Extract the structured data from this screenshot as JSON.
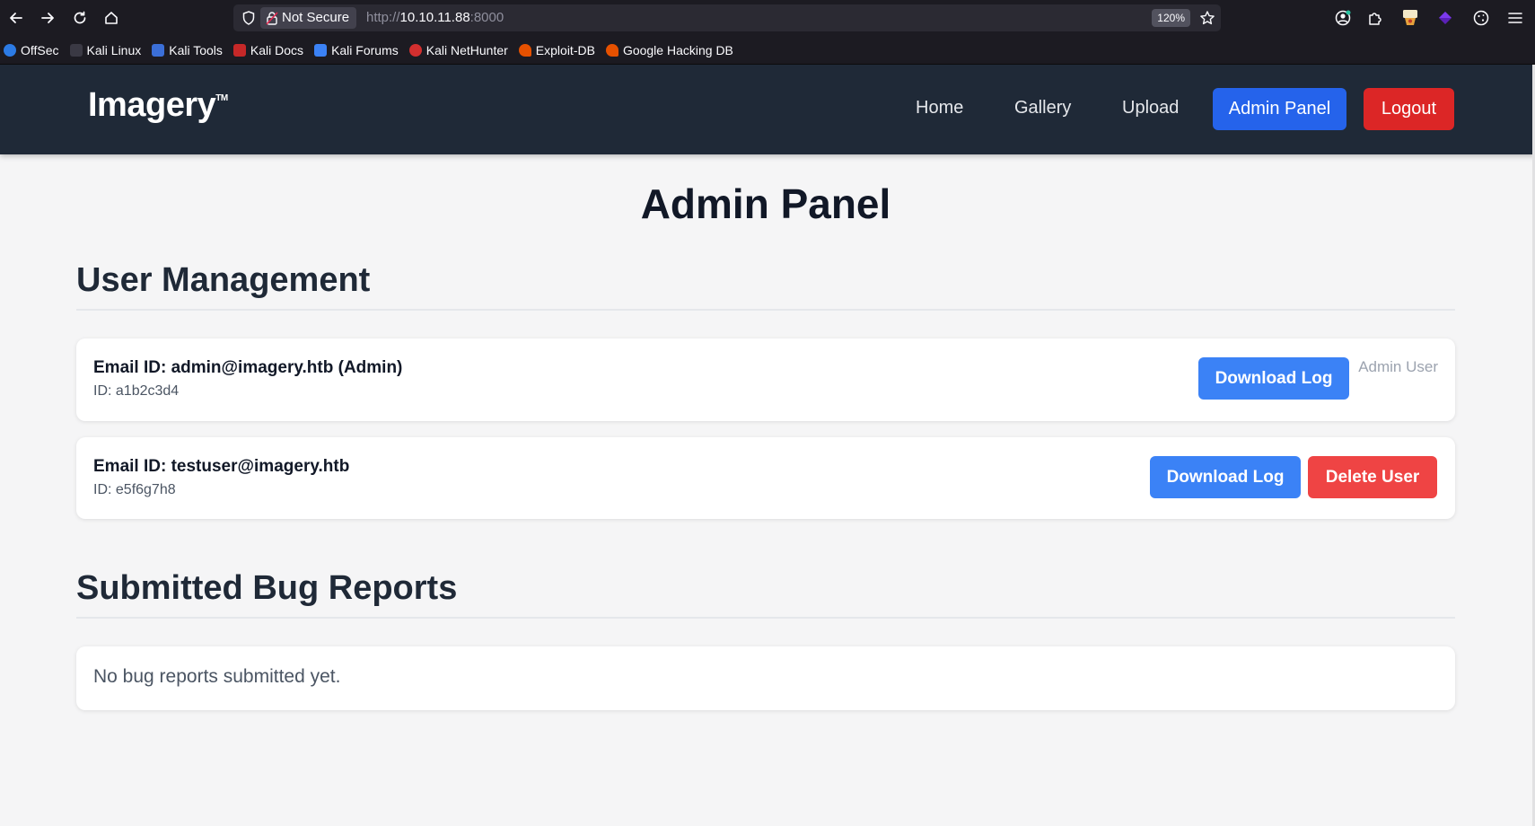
{
  "browser": {
    "security_label": "Not Secure",
    "url_prefix": "http://",
    "url_host": "10.10.11.88",
    "url_port": ":8000",
    "zoom": "120%",
    "bookmarks": [
      {
        "label": "OffSec",
        "color": "#2c7be5"
      },
      {
        "label": "Kali Linux",
        "color": "#1c1b22"
      },
      {
        "label": "Kali Tools",
        "color": "#3b6fd8"
      },
      {
        "label": "Kali Docs",
        "color": "#c62828"
      },
      {
        "label": "Kali Forums",
        "color": "#3b82f6"
      },
      {
        "label": "Kali NetHunter",
        "color": "#d32f2f"
      },
      {
        "label": "Exploit-DB",
        "color": "#e65100"
      },
      {
        "label": "Google Hacking DB",
        "color": "#e65100"
      }
    ]
  },
  "header": {
    "logo": "Imagery",
    "logo_tm": "TM",
    "nav": {
      "home": "Home",
      "gallery": "Gallery",
      "upload": "Upload",
      "admin_panel": "Admin Panel",
      "logout": "Logout"
    },
    "colors": {
      "bg": "#1f2937",
      "admin": "#2563eb",
      "logout": "#dc2626"
    }
  },
  "main": {
    "title": "Admin Panel",
    "user_management": {
      "heading": "User Management",
      "users": [
        {
          "email_line": "Email ID: admin@imagery.htb (Admin)",
          "id_line": "ID: a1b2c3d4",
          "download_label": "Download Log",
          "note": "Admin User"
        },
        {
          "email_line": "Email ID: testuser@imagery.htb",
          "id_line": "ID: e5f6g7h8",
          "download_label": "Download Log",
          "delete_label": "Delete User"
        }
      ]
    },
    "bug_reports": {
      "heading": "Submitted Bug Reports",
      "empty_message": "No bug reports submitted yet."
    }
  }
}
